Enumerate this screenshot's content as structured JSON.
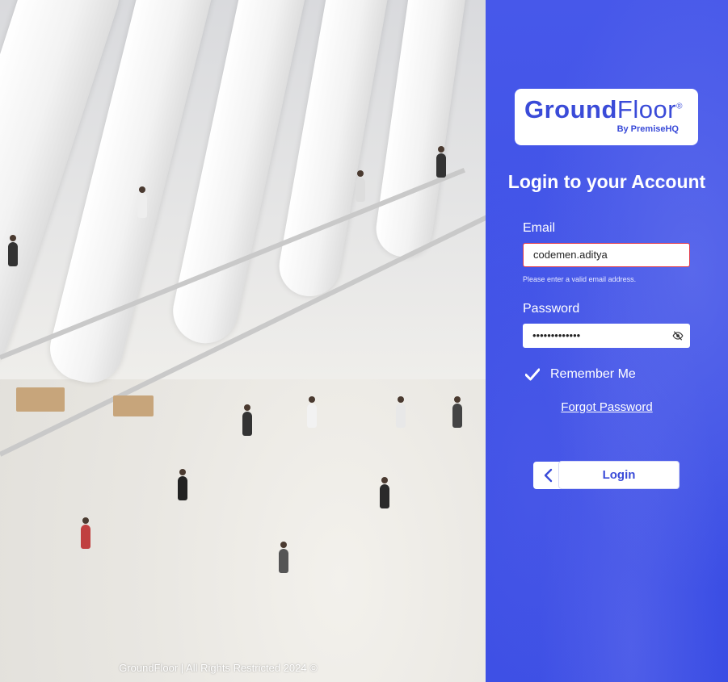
{
  "footer": {
    "text": "GroundFloor | All Rights Restricted 2024 ©"
  },
  "logo": {
    "word_bold": "Ground",
    "word_light": "Floor",
    "registered": "®",
    "byline": "By PremiseHQ"
  },
  "login": {
    "title": "Login to your Account",
    "email_label": "Email",
    "email_value": "codemen.aditya",
    "email_error": "Please enter a valid email address.",
    "password_label": "Password",
    "password_value": "•••••••••••••",
    "remember_label": "Remember Me",
    "remember_checked": true,
    "forgot_label": "Forgot Password",
    "login_label": "Login"
  },
  "colors": {
    "accent": "#3e51e6",
    "error": "#e0394a",
    "white": "#ffffff"
  },
  "icons": {
    "password_toggle": "eye-off-icon",
    "remember": "checkmark-icon",
    "back": "chevron-left-icon"
  }
}
